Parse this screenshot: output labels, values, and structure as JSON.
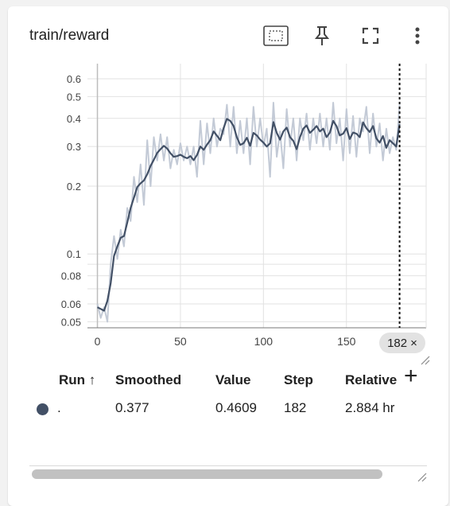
{
  "card": {
    "title": "train/reward"
  },
  "toolbar": {
    "icons": [
      "fit-domain-icon",
      "pin-icon",
      "fullscreen-icon",
      "more-vert-icon"
    ]
  },
  "chart_data": {
    "type": "line",
    "title": "",
    "xlabel": "",
    "ylabel": "",
    "scale_y": "log",
    "xlim": [
      -6,
      198
    ],
    "ylim": [
      0.047,
      0.7
    ],
    "x_ticks": [
      0,
      50,
      100,
      150
    ],
    "y_tick_labels": [
      {
        "v": 0.05,
        "t": "0.05"
      },
      {
        "v": 0.06,
        "t": "0.06"
      },
      {
        "v": 0.08,
        "t": "0.08"
      },
      {
        "v": 0.1,
        "t": "0.1"
      },
      {
        "v": 0.2,
        "t": "0.2"
      },
      {
        "v": 0.3,
        "t": "0.3"
      },
      {
        "v": 0.4,
        "t": "0.4"
      },
      {
        "v": 0.5,
        "t": "0.5"
      },
      {
        "v": 0.6,
        "t": "0.6"
      }
    ],
    "y_minor_grid": [
      0.07,
      0.09
    ],
    "hover_x": 182,
    "hover_label": "182",
    "series": [
      {
        "smoothed": [
          [
            0,
            0.058
          ],
          [
            2,
            0.057
          ],
          [
            4,
            0.056
          ],
          [
            6,
            0.062
          ],
          [
            8,
            0.074
          ],
          [
            10,
            0.098
          ],
          [
            12,
            0.108
          ],
          [
            14,
            0.118
          ],
          [
            16,
            0.12
          ],
          [
            18,
            0.138
          ],
          [
            20,
            0.16
          ],
          [
            22,
            0.178
          ],
          [
            24,
            0.198
          ],
          [
            26,
            0.206
          ],
          [
            28,
            0.212
          ],
          [
            30,
            0.226
          ],
          [
            32,
            0.246
          ],
          [
            34,
            0.262
          ],
          [
            36,
            0.281
          ],
          [
            38,
            0.292
          ],
          [
            40,
            0.302
          ],
          [
            42,
            0.294
          ],
          [
            44,
            0.28
          ],
          [
            46,
            0.27
          ],
          [
            48,
            0.272
          ],
          [
            50,
            0.276
          ],
          [
            52,
            0.27
          ],
          [
            54,
            0.266
          ],
          [
            56,
            0.272
          ],
          [
            58,
            0.261
          ],
          [
            60,
            0.275
          ],
          [
            62,
            0.3
          ],
          [
            64,
            0.29
          ],
          [
            66,
            0.306
          ],
          [
            68,
            0.32
          ],
          [
            70,
            0.35
          ],
          [
            72,
            0.335
          ],
          [
            74,
            0.32
          ],
          [
            76,
            0.362
          ],
          [
            78,
            0.398
          ],
          [
            80,
            0.39
          ],
          [
            82,
            0.37
          ],
          [
            84,
            0.33
          ],
          [
            86,
            0.305
          ],
          [
            88,
            0.31
          ],
          [
            90,
            0.328
          ],
          [
            92,
            0.302
          ],
          [
            94,
            0.345
          ],
          [
            96,
            0.336
          ],
          [
            98,
            0.322
          ],
          [
            100,
            0.312
          ],
          [
            102,
            0.3
          ],
          [
            104,
            0.31
          ],
          [
            106,
            0.385
          ],
          [
            108,
            0.345
          ],
          [
            110,
            0.322
          ],
          [
            112,
            0.35
          ],
          [
            114,
            0.364
          ],
          [
            116,
            0.33
          ],
          [
            118,
            0.318
          ],
          [
            120,
            0.292
          ],
          [
            122,
            0.33
          ],
          [
            124,
            0.36
          ],
          [
            126,
            0.372
          ],
          [
            128,
            0.345
          ],
          [
            130,
            0.356
          ],
          [
            132,
            0.37
          ],
          [
            134,
            0.35
          ],
          [
            136,
            0.36
          ],
          [
            138,
            0.33
          ],
          [
            140,
            0.346
          ],
          [
            142,
            0.39
          ],
          [
            144,
            0.37
          ],
          [
            146,
            0.336
          ],
          [
            148,
            0.342
          ],
          [
            150,
            0.362
          ],
          [
            152,
            0.324
          ],
          [
            154,
            0.346
          ],
          [
            156,
            0.342
          ],
          [
            158,
            0.33
          ],
          [
            160,
            0.384
          ],
          [
            162,
            0.362
          ],
          [
            164,
            0.348
          ],
          [
            166,
            0.37
          ],
          [
            168,
            0.326
          ],
          [
            170,
            0.312
          ],
          [
            172,
            0.334
          ],
          [
            174,
            0.296
          ],
          [
            176,
            0.32
          ],
          [
            178,
            0.31
          ],
          [
            180,
            0.3
          ],
          [
            182,
            0.377
          ]
        ],
        "raw": [
          [
            0,
            0.06
          ],
          [
            2,
            0.052
          ],
          [
            4,
            0.058
          ],
          [
            6,
            0.05
          ],
          [
            8,
            0.09
          ],
          [
            10,
            0.12
          ],
          [
            12,
            0.095
          ],
          [
            14,
            0.128
          ],
          [
            16,
            0.108
          ],
          [
            18,
            0.16
          ],
          [
            20,
            0.14
          ],
          [
            22,
            0.22
          ],
          [
            24,
            0.17
          ],
          [
            26,
            0.25
          ],
          [
            28,
            0.165
          ],
          [
            30,
            0.32
          ],
          [
            32,
            0.2
          ],
          [
            34,
            0.33
          ],
          [
            36,
            0.26
          ],
          [
            38,
            0.34
          ],
          [
            40,
            0.26
          ],
          [
            42,
            0.33
          ],
          [
            44,
            0.24
          ],
          [
            46,
            0.29
          ],
          [
            48,
            0.25
          ],
          [
            50,
            0.31
          ],
          [
            52,
            0.26
          ],
          [
            54,
            0.3
          ],
          [
            56,
            0.25
          ],
          [
            58,
            0.3
          ],
          [
            60,
            0.22
          ],
          [
            62,
            0.39
          ],
          [
            64,
            0.25
          ],
          [
            66,
            0.38
          ],
          [
            68,
            0.28
          ],
          [
            70,
            0.4
          ],
          [
            72,
            0.3
          ],
          [
            74,
            0.36
          ],
          [
            76,
            0.34
          ],
          [
            78,
            0.46
          ],
          [
            80,
            0.3
          ],
          [
            82,
            0.45
          ],
          [
            84,
            0.28
          ],
          [
            86,
            0.39
          ],
          [
            88,
            0.28
          ],
          [
            90,
            0.4
          ],
          [
            92,
            0.25
          ],
          [
            94,
            0.45
          ],
          [
            96,
            0.3
          ],
          [
            98,
            0.4
          ],
          [
            100,
            0.3
          ],
          [
            102,
            0.36
          ],
          [
            104,
            0.22
          ],
          [
            106,
            0.47
          ],
          [
            108,
            0.27
          ],
          [
            110,
            0.35
          ],
          [
            112,
            0.24
          ],
          [
            114,
            0.44
          ],
          [
            116,
            0.3
          ],
          [
            118,
            0.4
          ],
          [
            120,
            0.26
          ],
          [
            122,
            0.4
          ],
          [
            124,
            0.32
          ],
          [
            126,
            0.42
          ],
          [
            128,
            0.29
          ],
          [
            130,
            0.4
          ],
          [
            132,
            0.31
          ],
          [
            134,
            0.42
          ],
          [
            136,
            0.3
          ],
          [
            138,
            0.4
          ],
          [
            140,
            0.29
          ],
          [
            142,
            0.47
          ],
          [
            144,
            0.31
          ],
          [
            146,
            0.4
          ],
          [
            148,
            0.26
          ],
          [
            150,
            0.44
          ],
          [
            152,
            0.28
          ],
          [
            154,
            0.41
          ],
          [
            156,
            0.27
          ],
          [
            158,
            0.4
          ],
          [
            160,
            0.35
          ],
          [
            162,
            0.45
          ],
          [
            164,
            0.28
          ],
          [
            166,
            0.42
          ],
          [
            168,
            0.3
          ],
          [
            170,
            0.38
          ],
          [
            172,
            0.26
          ],
          [
            174,
            0.36
          ],
          [
            176,
            0.28
          ],
          [
            178,
            0.33
          ],
          [
            180,
            0.29
          ],
          [
            182,
            0.4609
          ]
        ]
      }
    ]
  },
  "table": {
    "headers": [
      "Run ↑",
      "Smoothed",
      "Value",
      "Step",
      "Relative"
    ],
    "add_label": "+",
    "rows": [
      {
        "color": "#425066",
        "run": ".",
        "smoothed": "0.377",
        "value": "0.4609",
        "step": "182",
        "relative": "2.884 hr"
      }
    ]
  },
  "colors": {
    "smoothed_line": "#425066",
    "raw_line": "#c3cad6",
    "grid": "#e2e2e2",
    "axis": "#777777"
  }
}
